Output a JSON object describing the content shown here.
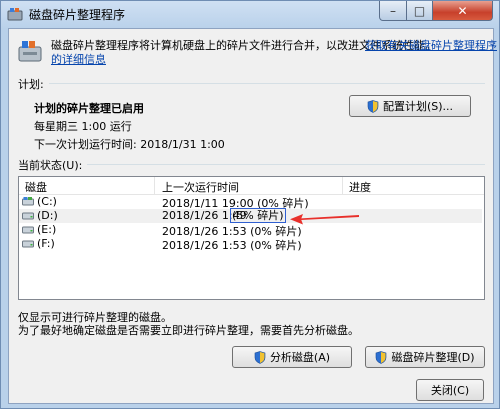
{
  "window": {
    "title": "磁盘碎片整理程序",
    "controls": {
      "minimize": "–",
      "maximize": "□",
      "close": "✕"
    }
  },
  "intro": {
    "text": "磁盘碎片整理程序将计算机硬盘上的碎片文件进行合并，以改进文件系统性能。",
    "link_line1": "获取有关磁盘碎片整理程序",
    "link_line2": "的详细信息"
  },
  "schedule": {
    "section_label": "计划:",
    "status": "计划的碎片整理已启用",
    "frequency": "每星期三  1:00 运行",
    "next_run": "下一次计划运行时间: 2018/1/31 1:00",
    "configure_button": "配置计划(S)..."
  },
  "current_status": {
    "section_label": "当前状态(U):",
    "columns": [
      "磁盘",
      "上一次运行时间",
      "进度"
    ],
    "rows": [
      {
        "disk": "(C:)",
        "last_run": "2018/1/11 19:00 (0% 碎片)",
        "progress": ""
      },
      {
        "disk": "(D:)",
        "last_run_time": "2018/1/26 1:49",
        "last_run_frag": "(5% 碎片)",
        "progress": "",
        "selected": true
      },
      {
        "disk": "(E:)",
        "last_run": "2018/1/26 1:53 (0% 碎片)",
        "progress": ""
      },
      {
        "disk": "(F:)",
        "last_run": "2018/1/26 1:53 (0% 碎片)",
        "progress": ""
      }
    ]
  },
  "notes": {
    "line1": "仅显示可进行碎片整理的磁盘。",
    "line2": "为了最好地确定磁盘是否需要立即进行碎片整理，需要首先分析磁盘。"
  },
  "actions": {
    "analyze": "分析磁盘(A)",
    "defragment": "磁盘碎片整理(D)",
    "close": "关闭(C)"
  },
  "colors": {
    "annotation_box": "#2f5fd0",
    "annotation_arrow": "#e8302b",
    "link": "#0645ad"
  }
}
